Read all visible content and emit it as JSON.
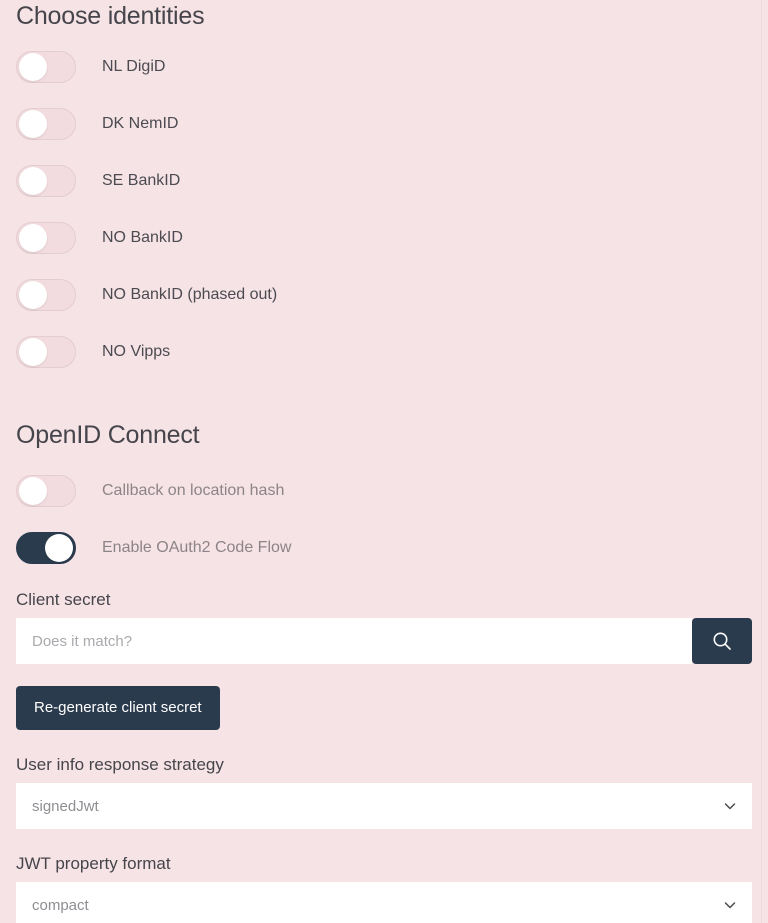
{
  "identities": {
    "heading": "Choose identities",
    "items": [
      {
        "label": "NL DigiD",
        "on": false
      },
      {
        "label": "DK NemID",
        "on": false
      },
      {
        "label": "SE BankID",
        "on": false
      },
      {
        "label": "NO BankID",
        "on": false
      },
      {
        "label": "NO BankID (phased out)",
        "on": false
      },
      {
        "label": "NO Vipps",
        "on": false
      }
    ]
  },
  "oidc": {
    "heading": "OpenID Connect",
    "toggles": [
      {
        "label": "Callback on location hash",
        "on": false
      },
      {
        "label": "Enable OAuth2 Code Flow",
        "on": true
      }
    ],
    "client_secret": {
      "label": "Client secret",
      "value": "",
      "placeholder": "Does it match?",
      "search_icon": "search-icon"
    },
    "regenerate_button": "Re-generate client secret",
    "user_info_strategy": {
      "label": "User info response strategy",
      "value": "signedJwt",
      "chevron_icon": "chevron-down-icon"
    },
    "jwt_property_format": {
      "label": "JWT property format",
      "value": "compact",
      "chevron_icon": "chevron-down-icon"
    }
  },
  "colors": {
    "background": "#f6e3e5",
    "accent_dark": "#2b3b4e",
    "field_background": "#ffffff",
    "toggle_off_track": "#f2dcdf",
    "text": "#45454b"
  }
}
